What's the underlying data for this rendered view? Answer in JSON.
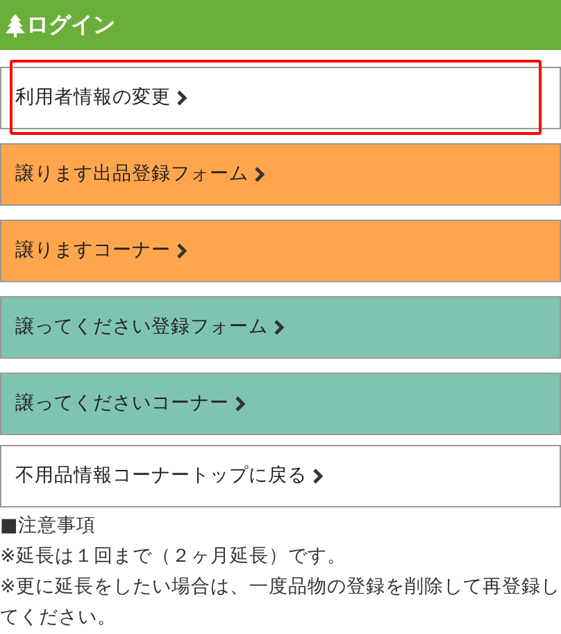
{
  "header": {
    "title": "ログイン"
  },
  "menu": [
    {
      "label": "利用者情報の変更",
      "color": "#ffffff",
      "highlighted": true
    },
    {
      "label": "譲ります出品登録フォーム",
      "color": "#ffa64d",
      "highlighted": false
    },
    {
      "label": "譲りますコーナー",
      "color": "#ffa64d",
      "highlighted": false
    },
    {
      "label": "譲ってください登録フォーム",
      "color": "#7fc4b3",
      "highlighted": false
    },
    {
      "label": "譲ってくださいコーナー",
      "color": "#7fc4b3",
      "highlighted": false
    },
    {
      "label": "不用品情報コーナートップに戻る",
      "color": "#ffffff",
      "highlighted": false
    }
  ],
  "notes": {
    "heading": "■注意事項",
    "lines": [
      "※延長は１回まで（２ヶ月延長）です。",
      "※更に延長をしたい場合は、一度品物の登録を削除して再登録してください。"
    ]
  }
}
